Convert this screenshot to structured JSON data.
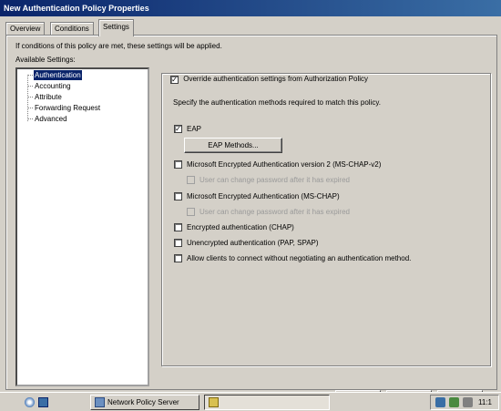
{
  "window": {
    "title": "New Authentication Policy Properties"
  },
  "tabs": [
    {
      "label": "Overview"
    },
    {
      "label": "Conditions"
    },
    {
      "label": "Settings"
    }
  ],
  "settings": {
    "intro": "If conditions of this policy are met, these settings will be applied.",
    "available_label": "Available Settings:",
    "tree": [
      {
        "label": "Authentication",
        "selected": true
      },
      {
        "label": "Accounting"
      },
      {
        "label": "Attribute"
      },
      {
        "label": "Forwarding Request"
      },
      {
        "label": "Advanced"
      }
    ]
  },
  "auth": {
    "override_label": "Override authentication settings from Authorization Policy",
    "override_checked": true,
    "specify_text": "Specify the authentication methods required to match this policy.",
    "eap_label": "EAP",
    "eap_checked": true,
    "eap_methods_button": "EAP Methods...",
    "mschapv2_label": "Microsoft Encrypted Authentication version 2 (MS-CHAP-v2)",
    "mschapv2_pw_label": "User can change password after it has expired",
    "mschap_label": "Microsoft Encrypted Authentication (MS-CHAP)",
    "mschap_pw_label": "User can change password after it has expired",
    "chap_label": "Encrypted authentication (CHAP)",
    "pap_label": "Unencrypted authentication (PAP, SPAP)",
    "nomethod_label": "Allow clients to connect without negotiating an authentication method."
  },
  "taskbar": {
    "task1_label": "Network Policy Server",
    "clock": "11:1"
  },
  "colors": {
    "title_gradient_start": "#0a246a",
    "title_gradient_end": "#3a6ea5",
    "face": "#d4d0c8",
    "selection": "#0a246a"
  }
}
